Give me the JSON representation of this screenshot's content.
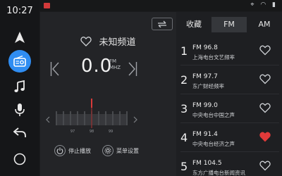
{
  "status": {
    "clock": "10:27",
    "icons": [
      "location-icon",
      "wifi-icon",
      "signal-icon"
    ]
  },
  "rail": {
    "items": [
      {
        "name": "navigation-icon",
        "active": false
      },
      {
        "name": "radio-icon",
        "active": true
      },
      {
        "name": "music-icon",
        "active": false
      },
      {
        "name": "microphone-icon",
        "active": false
      },
      {
        "name": "back-icon",
        "active": false
      },
      {
        "name": "home-icon",
        "active": false
      }
    ]
  },
  "player": {
    "station_name": "未知频道",
    "frequency": "0.0",
    "unit_fm": "FM",
    "unit_mhz": "MHZ",
    "dial_labels": [
      "97",
      "98",
      "99"
    ],
    "stop_label": "停止播放",
    "menu_label": "菜单设置"
  },
  "tabs": [
    {
      "label": "收藏",
      "active": false
    },
    {
      "label": "FM",
      "active": true
    },
    {
      "label": "AM",
      "active": false
    }
  ],
  "favorites": [
    {
      "num": "1",
      "freq": "FM 96.8",
      "name": "上海电台文艺频率",
      "favorited": false
    },
    {
      "num": "2",
      "freq": "FM 97.7",
      "name": "东广财经频率",
      "favorited": false
    },
    {
      "num": "3",
      "freq": "FM 99.0",
      "name": "中央电台中国之声",
      "favorited": false
    },
    {
      "num": "4",
      "freq": "FM 91.4",
      "name": "中央电台经济之声",
      "favorited": true
    },
    {
      "num": "5",
      "freq": "FM 104.5",
      "name": "东方广播电台新闻资讯",
      "favorited": false
    }
  ],
  "colors": {
    "accent": "#2f8df2",
    "favorite": "#e03a3a",
    "needle": "#d83a3a"
  }
}
